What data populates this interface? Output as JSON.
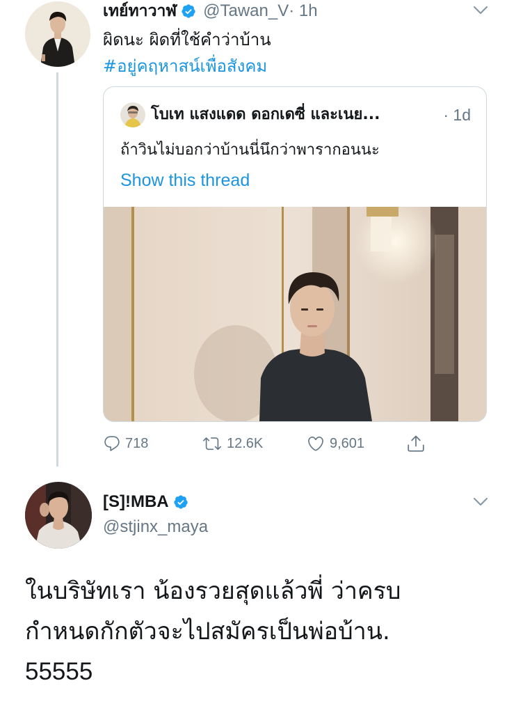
{
  "tweet": {
    "author": {
      "display_name": "เทย์ทาวาฬ",
      "handle": "@Tawan_V",
      "verified": true,
      "avatar_icon": "profile-photo-man-in-black-jacket"
    },
    "time": "· 1h",
    "text": "ผิดนะ ผิดที่ใช้คำว่าบ้าน",
    "hashtag": "#อยู่คฤหาสน์เพื่อสังคม",
    "quoted": {
      "author_display": "โบเท แสงแดด ดอกเดซี่ และเนย...",
      "time": "· 1d",
      "text": "ถ้าวินไม่บอกว่าบ้านนี่นึกว่าพารากอนนะ",
      "thread_link": "Show this thread",
      "photo_icon": "photo-man-in-dark-sweater-indoors"
    },
    "actions": {
      "reply_count": "718",
      "retweet_count": "12.6K",
      "like_count": "9,601"
    }
  },
  "reply": {
    "author": {
      "display_name": "[S]!MBA",
      "handle": "@stjinx_maya",
      "verified": true,
      "avatar_icon": "profile-photo-man-in-white-shirt"
    },
    "text_lines": [
      "ในบริษัทเรา น้องรวยสุดแล้วพี่ ว่าครบ",
      "กำหนดกักตัวจะไปสมัครเป็นพ่อบ้าน.",
      "55555"
    ]
  },
  "colors": {
    "link_blue": "#1b95e0",
    "verified_blue": "#1da1f2",
    "muted_gray": "#657786",
    "border_gray": "#cfd9de",
    "text_black": "#14171a"
  }
}
